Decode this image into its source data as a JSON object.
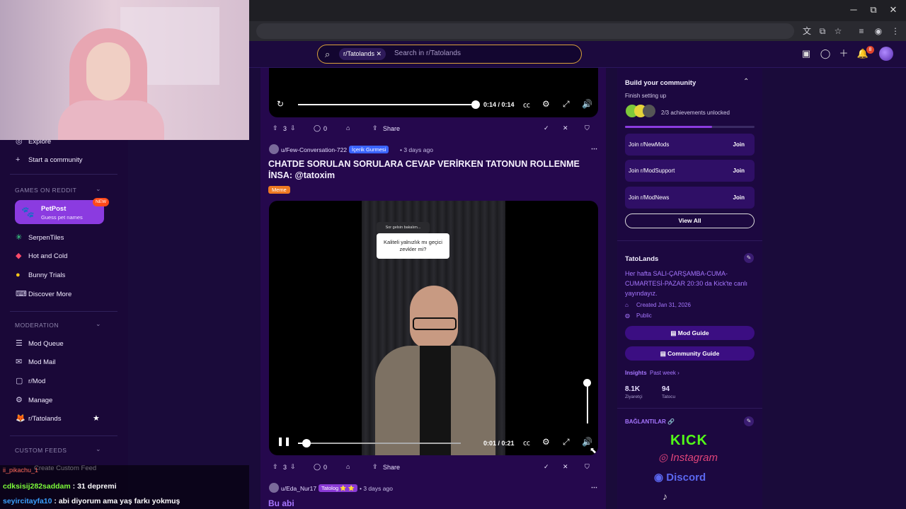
{
  "browser": {
    "controls": {
      "minimize": "─",
      "maximize": "⧉",
      "close": "✕"
    },
    "toolbar_icons": [
      "translate-icon",
      "install-icon",
      "star-icon",
      "tab-search-icon",
      "profile-icon",
      "menu-icon"
    ]
  },
  "header": {
    "search_chip": "r/Tatolands",
    "search_placeholder": "Search in r/Tatolands",
    "notification_count": "8"
  },
  "sidebar": {
    "items_top": [
      {
        "label": "Explore",
        "icon": "◎"
      },
      {
        "label": "Start a community",
        "icon": "+"
      }
    ],
    "games_section": "GAMES ON REDDIT",
    "petpost": {
      "title": "PetPost",
      "subtitle": "Guess pet names",
      "badge": "NEW"
    },
    "games": [
      {
        "label": "SerpenTiles"
      },
      {
        "label": "Hot and Cold"
      },
      {
        "label": "Bunny Trials"
      },
      {
        "label": "Discover More"
      }
    ],
    "moderation_section": "MODERATION",
    "moderation": [
      {
        "label": "Mod Queue",
        "icon": "☰"
      },
      {
        "label": "Mod Mail",
        "icon": "✉"
      },
      {
        "label": "r/Mod",
        "icon": "▢"
      },
      {
        "label": "Manage",
        "icon": "⚙"
      },
      {
        "label": "r/Tatolands",
        "icon": "🦊"
      }
    ],
    "custom_feeds_section": "CUSTOM FEEDS",
    "create_custom_feed": "Create Custom Feed"
  },
  "feed": {
    "video1": {
      "time": "0:14 / 0:14",
      "progress": 1.0
    },
    "actions1": {
      "votes": "3",
      "comments": "0",
      "share": "Share"
    },
    "post2": {
      "user": "u/Few-Conversation-722",
      "flair": "İçerik Gurmesi",
      "time": "• 3 days ago",
      "title": "CHATDE SORULAN SORULARA CEVAP VERİRKEN TATONUN ROLLENME İNSA: @tatoxim",
      "post_flair": "Meme",
      "question_header": "Sor gelsin bakalım...",
      "question": "Kaliteli yalnızlık mı geçici zevkler mi?",
      "video_time": "0:01 / 0:21",
      "progress": 0.05,
      "volume": 1.0
    },
    "actions2": {
      "votes": "3",
      "comments": "0",
      "share": "Share"
    },
    "post3": {
      "user": "u/Eda_Nur17",
      "flair": "Tatolog ⭐ ⭐",
      "time": "• 3 days ago",
      "title": "Bu abi"
    }
  },
  "right_sidebar": {
    "build": {
      "title": "Build your community",
      "subtitle": "Finish setting up",
      "achievements": "2/3 achievements unlocked",
      "progress": 0.67
    },
    "joins": [
      {
        "name": "Join r/NewMods",
        "button": "Join"
      },
      {
        "name": "Join r/ModSupport",
        "button": "Join"
      },
      {
        "name": "Join r/ModNews",
        "button": "Join"
      }
    ],
    "view_all": "View All",
    "community": {
      "name": "TatoLands",
      "description": "Her hafta SALI-ÇARŞAMBA-CUMA-CUMARTESİ-PAZAR 20:30 da Kick'te canlı yayındayız.",
      "created": "Created Jan 31, 2026",
      "visibility": "Public",
      "mod_guide": "Mod Guide",
      "community_guide": "Community Guide",
      "insights": "Insights",
      "insights_period": "Past week ›",
      "stat1_value": "8.1K",
      "stat1_label": "Ziyaretçi",
      "stat2_value": "94",
      "stat2_label": "Tatocu"
    },
    "links_title": "BAĞLANTILAR 🔗",
    "links": {
      "kick": "KICK",
      "instagram": "Instagram",
      "discord": "Discord"
    }
  },
  "chat": [
    {
      "user": "cdksisij282saddam",
      "message": ": 31 depremi",
      "color": "#7CFC3A"
    },
    {
      "user": "seyircitayfa10",
      "message": ": abi diyorum ama yaş farkı yokmuş",
      "color": "#3aa0ff"
    }
  ],
  "chat_top_name": "ii_pikachu_1",
  "colors": {
    "accent": "#8b3be0",
    "search_border": "#d9a23a",
    "kick_green": "#53fc18",
    "reddit_bg": "#25084d"
  }
}
